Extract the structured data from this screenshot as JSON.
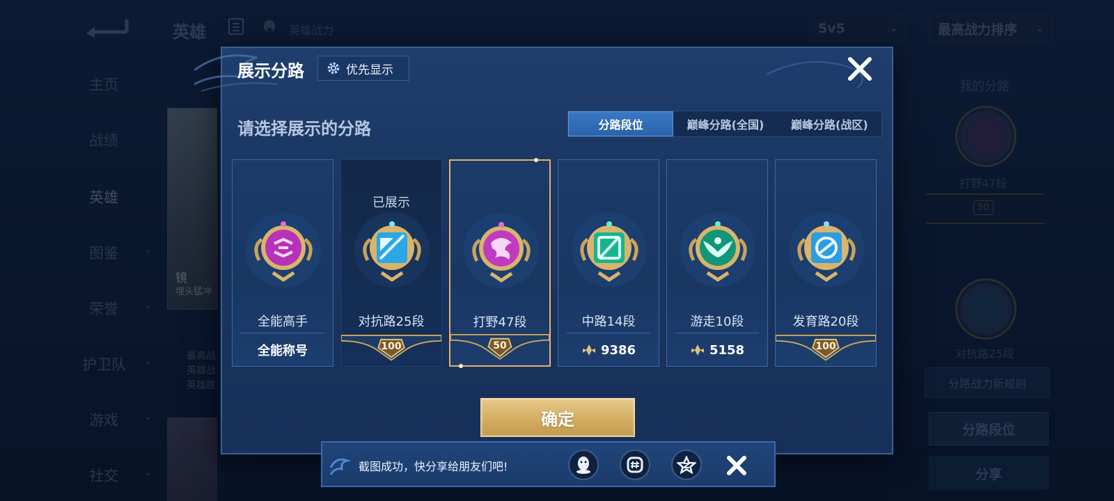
{
  "background": {
    "top_title": "英雄",
    "top_subtitle": "英雄战力",
    "mode_select": "5v5",
    "sort_select": "最高战力排序",
    "sidebar": [
      {
        "label": "主页"
      },
      {
        "label": "战绩"
      },
      {
        "label": "英雄"
      },
      {
        "label": "图鉴"
      },
      {
        "label": "荣誉"
      },
      {
        "label": "护卫队"
      },
      {
        "label": "游戏"
      },
      {
        "label": "社交"
      }
    ],
    "hero_name": "镜",
    "hero_subtitle": "埋头猛冲",
    "hero_info_lines": [
      "最高战",
      "英雄战",
      "英雄胜"
    ],
    "right_panel": {
      "title": "我的分路",
      "lane1": "打野47段",
      "lane1_rank": "50",
      "lane2": "对抗路25段",
      "rules": "分路战力新规则",
      "lane_rank_btn": "分路段位",
      "share_btn": "分享"
    }
  },
  "modal": {
    "title": "展示分路",
    "priority_button": "优先显示",
    "prompt": "请选择展示的分路",
    "tabs": [
      {
        "label": "分路段位",
        "active": true
      },
      {
        "label": "巅峰分路(全国)",
        "active": false
      },
      {
        "label": "巅峰分路(战区)",
        "active": false
      }
    ],
    "cards": [
      {
        "name": "全能高手",
        "bottom_text": "全能称号",
        "badge": "all-round-badge",
        "shown": ""
      },
      {
        "name": "对抗路25段",
        "rank": "100",
        "badge": "clash-lane-badge",
        "shown": "已展示"
      },
      {
        "name": "打野47段",
        "rank": "50",
        "badge": "jungle-badge",
        "shown": "",
        "selected": true
      },
      {
        "name": "中路14段",
        "score": "9386",
        "badge": "mid-lane-badge",
        "shown": ""
      },
      {
        "name": "游走10段",
        "score": "5158",
        "badge": "roam-badge",
        "shown": ""
      },
      {
        "name": "发育路20段",
        "rank": "100",
        "badge": "farm-lane-badge",
        "shown": ""
      }
    ],
    "confirm": "确定"
  },
  "toast": {
    "text": "截图成功，快分享给朋友们吧!",
    "share_icons": [
      "qq-icon",
      "wechat-moments-icon",
      "qzone-icon"
    ]
  },
  "colors": {
    "accent_gold": "#d3ad62",
    "tab_active": "#2c63ab",
    "modal_bg": "#1a3560"
  }
}
